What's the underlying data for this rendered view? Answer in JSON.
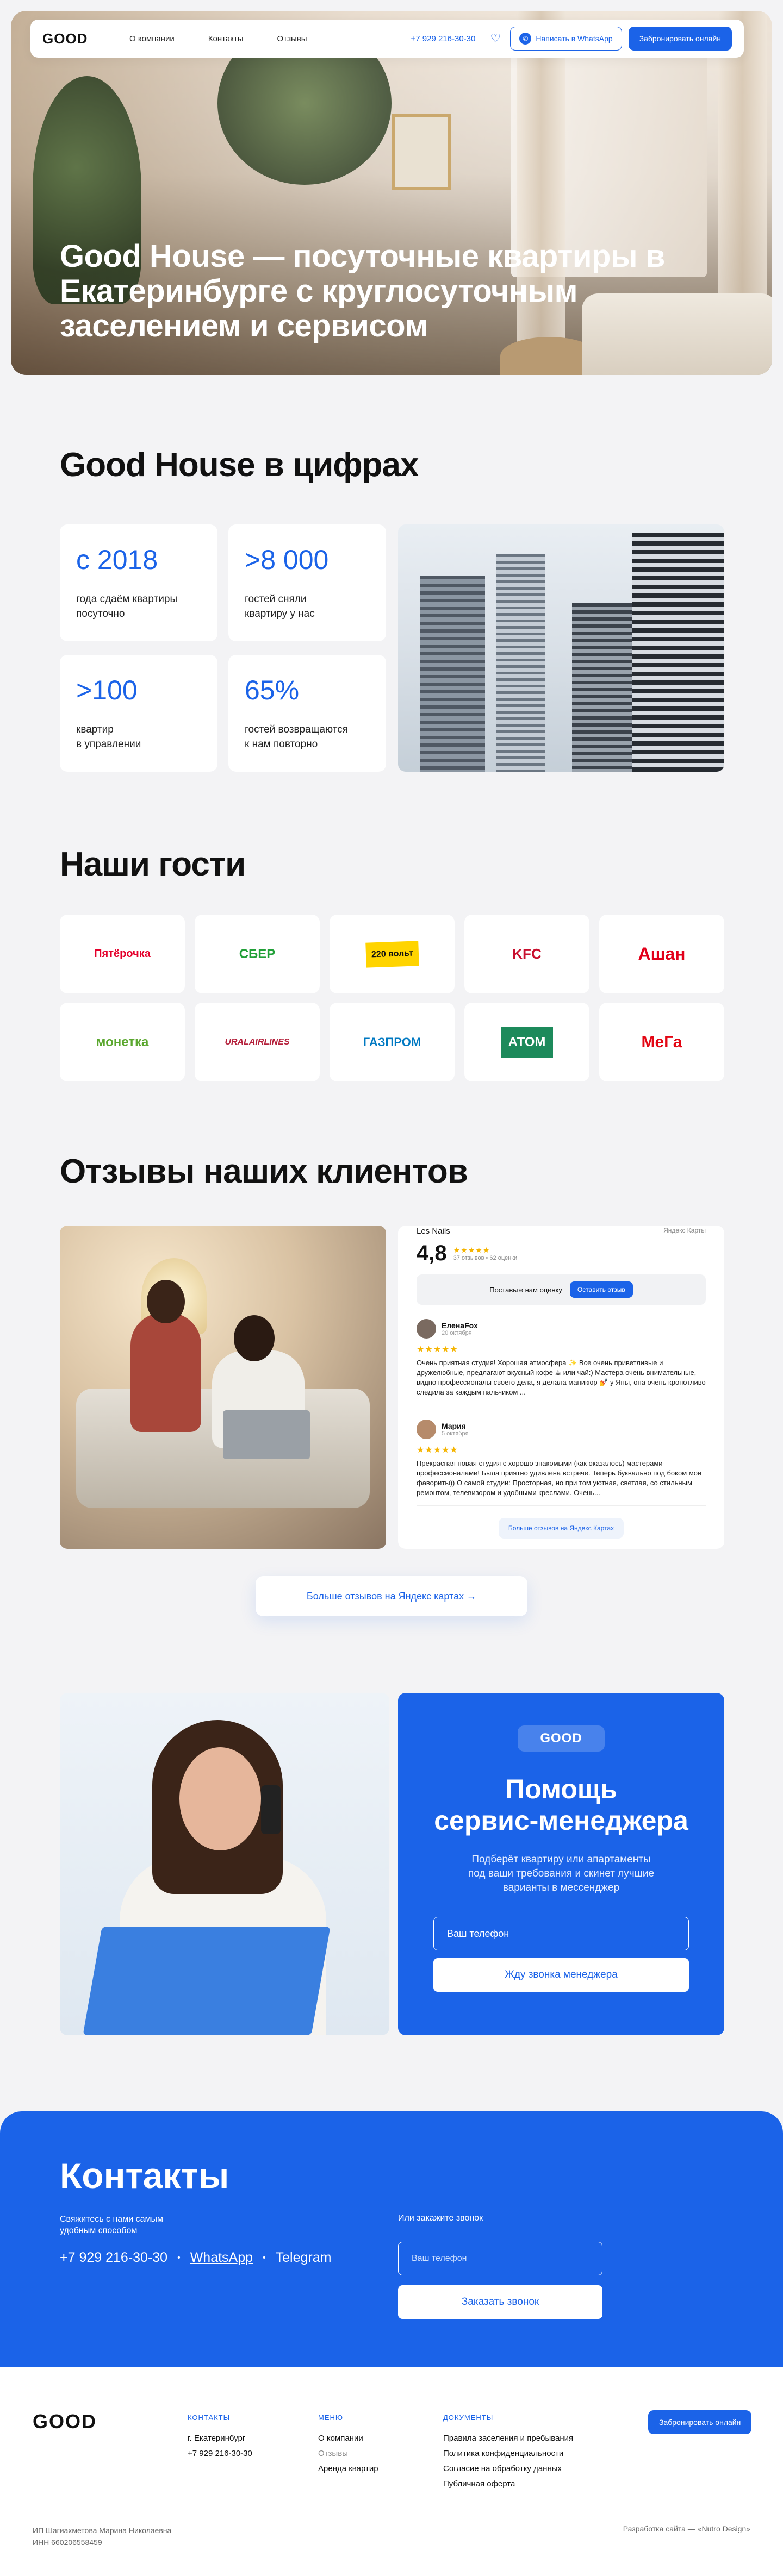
{
  "nav": {
    "logo": "GOOD",
    "links": [
      "О компании",
      "Контакты",
      "Отзывы"
    ],
    "phone": "+7 929 216-30-30",
    "whatsapp": "Написать в WhatsApp",
    "book": "Забронировать онлайн"
  },
  "hero": {
    "title": "Good House — посуточные квартиры в Екатеринбурге с круглосуточным заселением и сервисом"
  },
  "stats": {
    "title": "Good House в цифрах",
    "items": [
      {
        "num": "с 2018",
        "text": "года сдаём квартиры\nпосуточно"
      },
      {
        "num": ">8 000",
        "text": "гостей сняли\nквартиру у нас"
      },
      {
        "num": ">100",
        "text": "квартир\nв управлении"
      },
      {
        "num": "65%",
        "text": "гостей возвращаются\nк нам повторно"
      }
    ]
  },
  "guests": {
    "title": "Наши гости",
    "logos": [
      {
        "text": "Пятёрочка",
        "color": "#e4002b"
      },
      {
        "text": "СБЕР",
        "color": "#21a038"
      },
      {
        "text": "220 вольт",
        "color": "#111111"
      },
      {
        "text": "KFC",
        "color": "#c8102e"
      },
      {
        "text": "Ашан",
        "color": "#e2001a"
      },
      {
        "text": "монетка",
        "color": "#5aa72e"
      },
      {
        "text": "URALAIRLINES",
        "color": "#b41f3a"
      },
      {
        "text": "ГАЗПРОМ",
        "color": "#0079c2"
      },
      {
        "text": "АТОМ",
        "color": "#1d8a5b"
      },
      {
        "text": "МеГа",
        "color": "#e30613"
      }
    ]
  },
  "reviews": {
    "title": "Отзывы наших клиентов",
    "widget": {
      "name": "Les Nails",
      "brand": "Яндекс Карты",
      "rating": "4,8",
      "count": "37 отзывов • 62 оценки",
      "rate_prompt": "Поставьте нам оценку",
      "leave": "Оставить отзыв",
      "items": [
        {
          "name": "ЕленаFox",
          "date": "20 октября",
          "text": "Очень приятная студия! Хорошая атмосфера ✨ Все очень приветливые и дружелюбные, предлагают вкусный кофе ☕ или чай:) Мастера очень внимательные, видно профессионалы своего дела, я делала маникюр 💅 у Яны, она очень кропотливо следила за каждым пальчиком ..."
        },
        {
          "name": "Мария",
          "date": "5 октября",
          "text": "Прекрасная новая студия с хорошо знакомыми (как оказалось) мастерами-профессионалами! Была приятно удивлена встрече. Теперь буквально под боком мои фавориты)) О самой студии: Просторная, но при том уютная, светлая, со стильным ремонтом, телевизором и удобными креслами. Очень..."
        }
      ],
      "more": "Больше отзывов на Яндекс Картах"
    },
    "more_button": "Больше отзывов на Яндекс картах →"
  },
  "manager": {
    "logo": "GOOD",
    "title": "Помощь\nсервис-менеджера",
    "text": "Подберёт квартиру или апартаменты\nпод ваши требования и скинет лучшие\nварианты в мессенджер",
    "placeholder": "Ваш телефон",
    "button": "Жду звонка менеджера"
  },
  "contacts": {
    "title": "Контакты",
    "label": "Свяжитесь с нами самым\nудобным способом",
    "phone": "+7 929 216-30-30",
    "whatsapp": "WhatsApp",
    "telegram": "Telegram",
    "call_label": "Или закажите звонок",
    "placeholder": "Ваш телефон",
    "button": "Заказать звонок"
  },
  "footer": {
    "logo": "GOOD",
    "contacts_h": "КОНТАКТЫ",
    "city": "г. Екатеринбург",
    "phone": "+7 929 216-30-30",
    "menu_h": "МЕНЮ",
    "menu": [
      "О компании",
      "Отзывы",
      "Аренда квартир"
    ],
    "docs_h": "ДОКУМЕНТЫ",
    "docs": [
      "Правила заселения и пребывания",
      "Политика конфиденциальности",
      "Согласие на обработку данных",
      "Публичная оферта"
    ],
    "book": "Забронировать онлайн",
    "legal": "ИП Шагиахметова Марина Николаевна\nИНН 660206558459",
    "dev": "Разработка сайта — «Nutro Design»"
  }
}
